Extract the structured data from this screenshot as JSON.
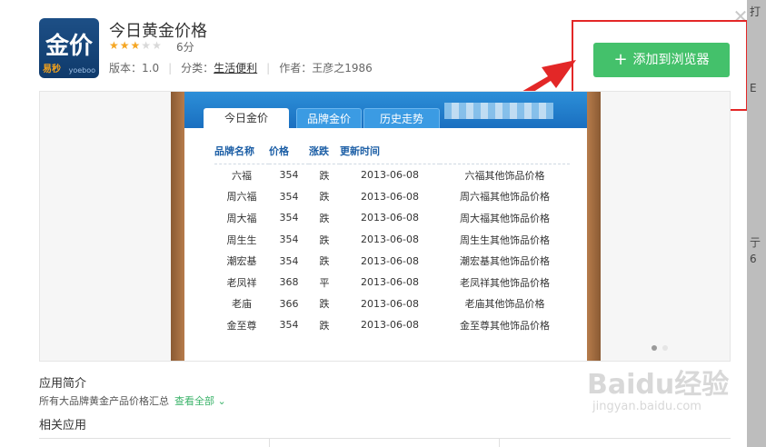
{
  "app": {
    "icon_text": "金价",
    "icon_sub": "易秒",
    "icon_sub2": "yoeboo",
    "title": "今日黄金价格",
    "rating_stars": 3,
    "rating_max": 5,
    "score": "6分",
    "version": "版本：1.0",
    "category_label": "分类：",
    "category": "生活便利",
    "author": "作者：王彦之1986",
    "add_button": "添加到浏览器",
    "close_icon": "close-icon"
  },
  "preview": {
    "tabs": [
      "今日金价",
      "品牌金价",
      "历史走势"
    ],
    "headers": [
      "品牌名称",
      "价格",
      "涨跌",
      "更新时间",
      ""
    ],
    "rows": [
      [
        "六福",
        "354",
        "跌",
        "2013-06-08",
        "六福其他饰品价格"
      ],
      [
        "周六福",
        "354",
        "跌",
        "2013-06-08",
        "周六福其他饰品价格"
      ],
      [
        "周大福",
        "354",
        "跌",
        "2013-06-08",
        "周大福其他饰品价格"
      ],
      [
        "周生生",
        "354",
        "跌",
        "2013-06-08",
        "周生生其他饰品价格"
      ],
      [
        "潮宏基",
        "354",
        "跌",
        "2013-06-08",
        "潮宏基其他饰品价格"
      ],
      [
        "老凤祥",
        "368",
        "平",
        "2013-06-08",
        "老凤祥其他饰品价格"
      ],
      [
        "老庙",
        "366",
        "跌",
        "2013-06-08",
        "老庙其他饰品价格"
      ],
      [
        "金至尊",
        "354",
        "跌",
        "2013-06-08",
        "金至尊其他饰品价格"
      ]
    ]
  },
  "intro": {
    "heading": "应用简介",
    "text": "所有大品牌黄金产品价格汇总",
    "view_all": "查看全部 ⌄"
  },
  "related": {
    "heading": "相关应用"
  },
  "background": {
    "right_texts": [
      "打",
      "E",
      "亍",
      "6"
    ]
  },
  "watermark": {
    "main": "Baidu经验",
    "sub": "jingyan.baidu.com"
  },
  "colors": {
    "add_button": "#44c16b",
    "highlight": "#e32727",
    "link": "#2a6db8"
  }
}
